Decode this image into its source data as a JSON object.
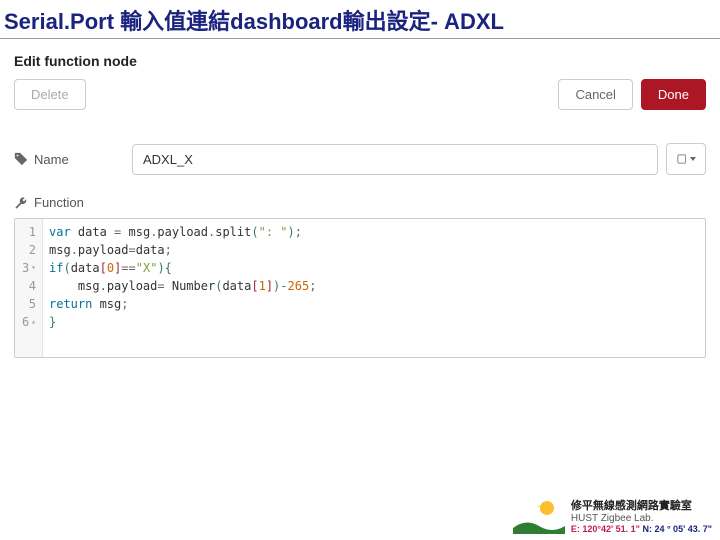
{
  "slide": {
    "title": "Serial.Port 輸入值連結dashboard輸出設定- ADXL"
  },
  "dialog": {
    "header": "Edit function node",
    "buttons": {
      "delete": "Delete",
      "cancel": "Cancel",
      "done": "Done"
    }
  },
  "form": {
    "name_label": "Name",
    "name_value": "ADXL_X",
    "function_label": "Function"
  },
  "code": {
    "lines": [
      {
        "n": "1",
        "fold": "",
        "tokens": [
          [
            "kw",
            "var"
          ],
          [
            "ident",
            " data "
          ],
          [
            "punct",
            "= "
          ],
          [
            "ident",
            "msg"
          ],
          [
            "punct",
            "."
          ],
          [
            "ident",
            "payload"
          ],
          [
            "punct",
            "."
          ],
          [
            "ident",
            "split"
          ],
          [
            "bracket1",
            "("
          ],
          [
            "str",
            "\": \""
          ],
          [
            "bracket1",
            ")"
          ],
          [
            "punct",
            ";"
          ]
        ]
      },
      {
        "n": "2",
        "fold": "",
        "tokens": [
          [
            "ident",
            "msg"
          ],
          [
            "punct",
            "."
          ],
          [
            "ident",
            "payload"
          ],
          [
            "punct",
            "="
          ],
          [
            "ident",
            "data"
          ],
          [
            "punct",
            ";"
          ]
        ]
      },
      {
        "n": "3",
        "fold": "▾",
        "tokens": [
          [
            "kw",
            "if"
          ],
          [
            "bracket1",
            "("
          ],
          [
            "ident",
            "data"
          ],
          [
            "bracket2",
            "["
          ],
          [
            "num",
            "0"
          ],
          [
            "bracket2",
            "]"
          ],
          [
            "punct",
            "=="
          ],
          [
            "str",
            "\"X\""
          ],
          [
            "bracket1",
            ")"
          ],
          [
            "bracket1",
            "{"
          ]
        ]
      },
      {
        "n": "4",
        "fold": "",
        "tokens": [
          [
            "ident",
            "    msg"
          ],
          [
            "punct",
            "."
          ],
          [
            "ident",
            "payload"
          ],
          [
            "punct",
            "= "
          ],
          [
            "ident",
            "Number"
          ],
          [
            "bracket1",
            "("
          ],
          [
            "ident",
            "data"
          ],
          [
            "bracket2",
            "["
          ],
          [
            "num",
            "1"
          ],
          [
            "bracket2",
            "]"
          ],
          [
            "bracket1",
            ")"
          ],
          [
            "punct",
            "-"
          ],
          [
            "num",
            "265"
          ],
          [
            "punct",
            ";"
          ]
        ]
      },
      {
        "n": "5",
        "fold": "",
        "tokens": [
          [
            "kw",
            "return"
          ],
          [
            "ident",
            " msg"
          ],
          [
            "punct",
            ";"
          ]
        ]
      },
      {
        "n": "6",
        "fold": "▴",
        "tokens": [
          [
            "bracket1",
            "}"
          ]
        ]
      }
    ]
  },
  "footer": {
    "lab_zh": "修平無線感測網路實驗室",
    "lab_en": "HUST Zigbee Lab.",
    "coord_e": "E: 120°42' 51. 1\"",
    "coord_n": "N: 24 ° 05' 43. 7\""
  }
}
